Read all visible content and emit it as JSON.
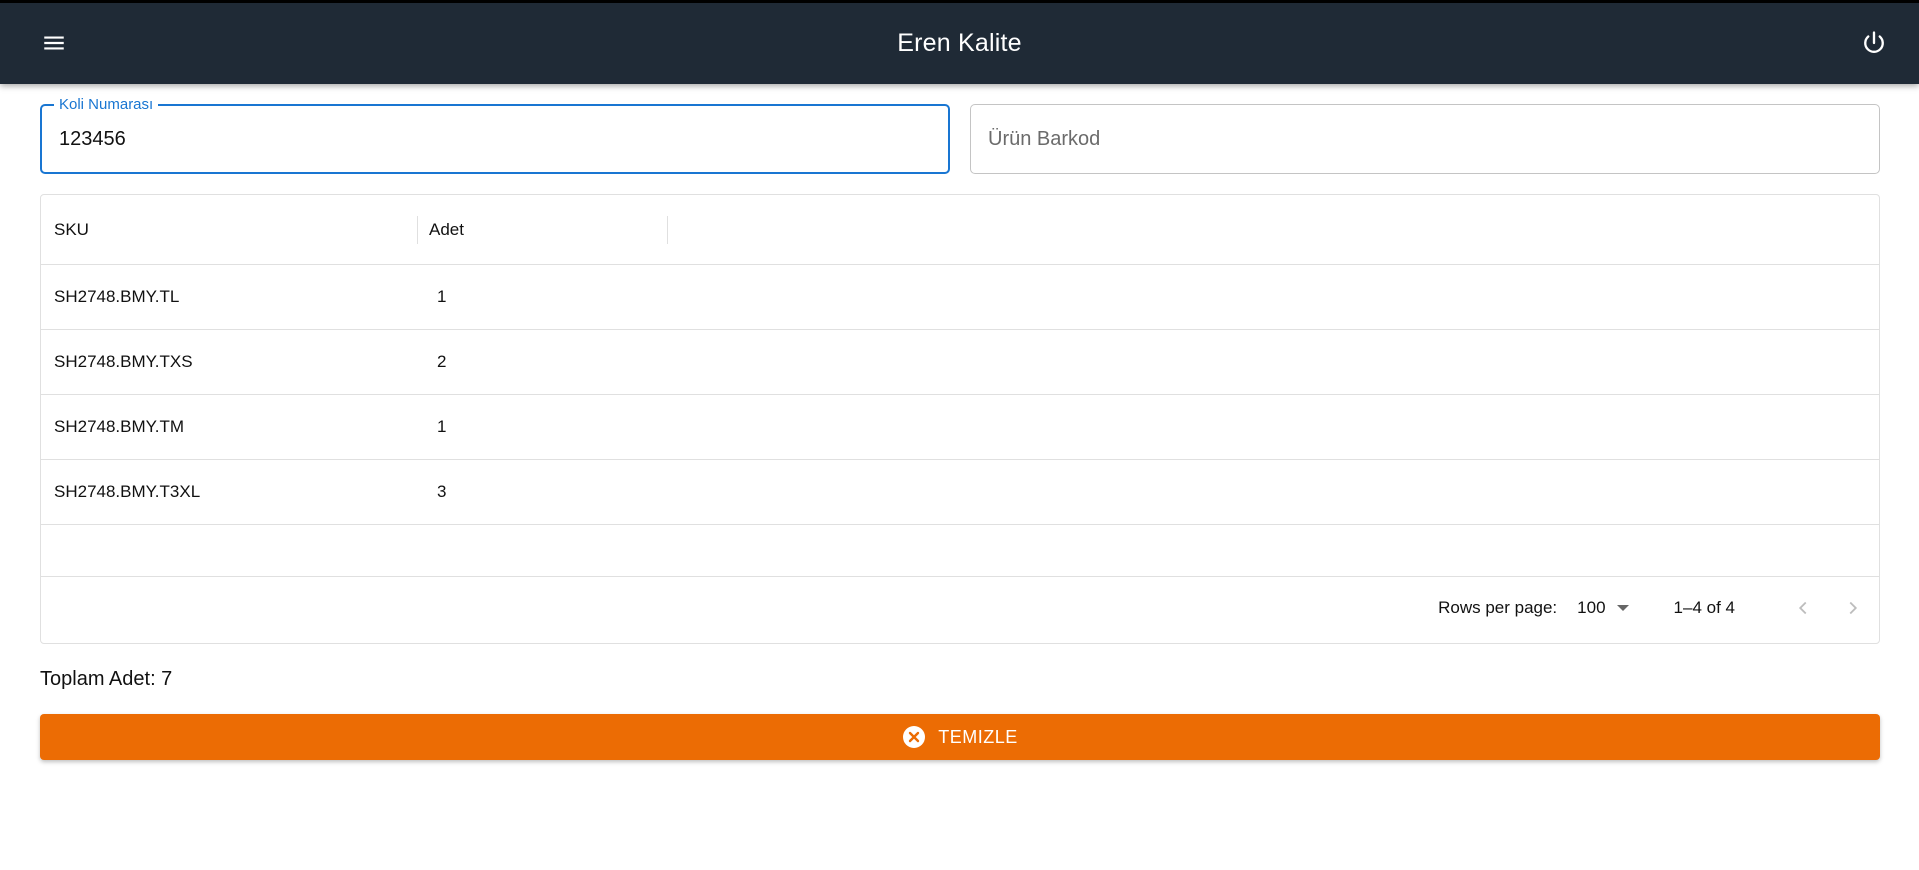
{
  "app": {
    "title": "Eren Kalite",
    "menu_icon": "menu-icon",
    "power_icon": "power-icon",
    "bar_color": "#1f2a36"
  },
  "form": {
    "koli": {
      "label": "Koli Numarası",
      "value": "123456"
    },
    "barkod": {
      "placeholder": "Ürün Barkod",
      "value": ""
    }
  },
  "table": {
    "columns": [
      "SKU",
      "Adet"
    ],
    "rows": [
      {
        "sku": "SH2748.BMY.TL",
        "adet": "1"
      },
      {
        "sku": "SH2748.BMY.TXS",
        "adet": "2"
      },
      {
        "sku": "SH2748.BMY.TM",
        "adet": "1"
      },
      {
        "sku": "SH2748.BMY.T3XL",
        "adet": "3"
      }
    ],
    "footer": {
      "rows_per_page_label": "Rows per page:",
      "rows_per_page_value": "100",
      "range": "1–4 of 4"
    }
  },
  "summary": {
    "total_text": "Toplam Adet: 7"
  },
  "actions": {
    "clear_label": "TEMIZLE",
    "clear_icon": "cancel-circle-icon",
    "clear_color": "#ec6c04"
  },
  "colors": {
    "primary": "#1976d2"
  }
}
